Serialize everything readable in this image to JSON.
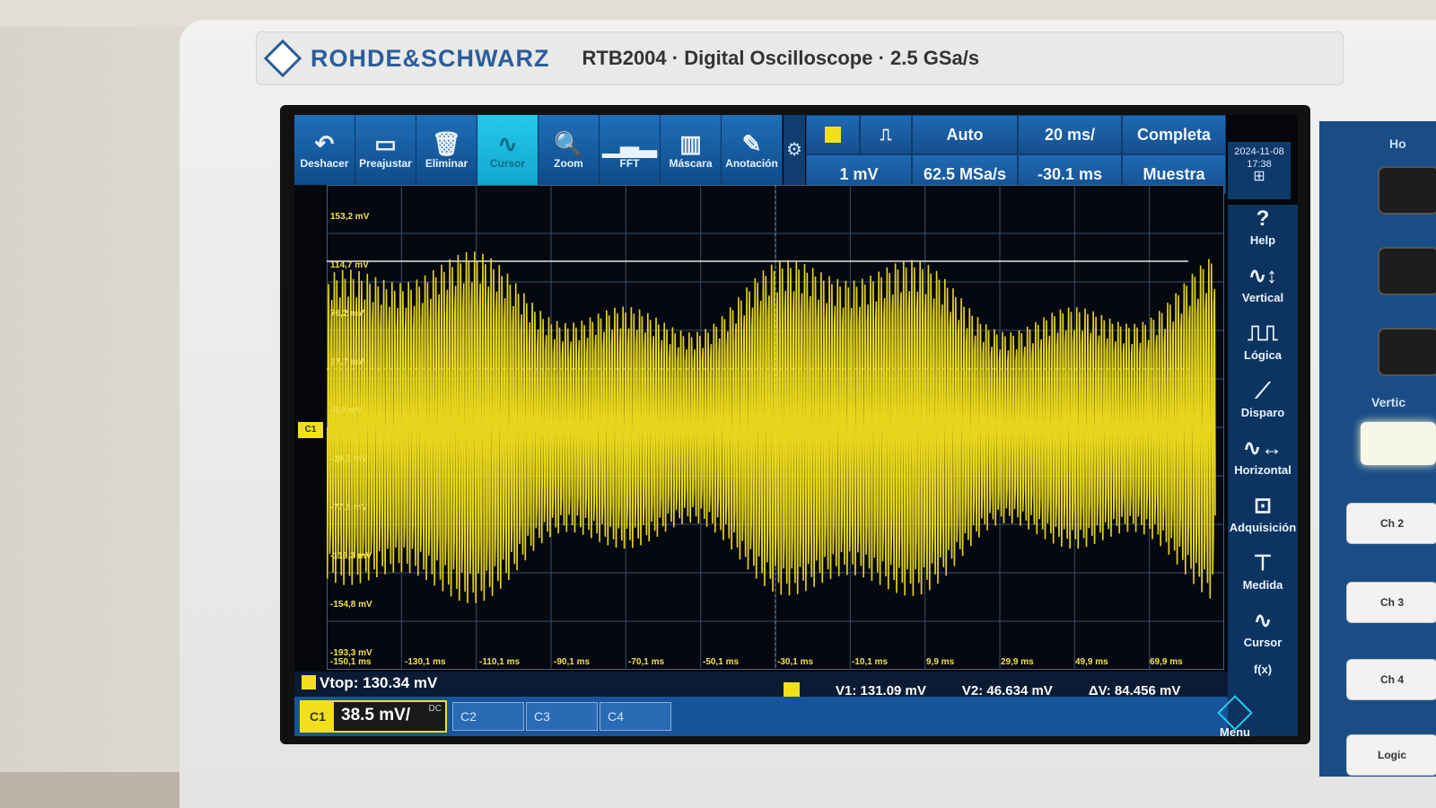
{
  "device": {
    "brand": "ROHDE&SCHWARZ",
    "model_line": "RTB2004 · Digital Oscilloscope · 2.5 GSa/s"
  },
  "toolbar": [
    {
      "label": "Deshacer",
      "icon": "undo-icon"
    },
    {
      "label": "Preajustar",
      "icon": "preset-icon"
    },
    {
      "label": "Eliminar",
      "icon": "trash-icon"
    },
    {
      "label": "Cursor",
      "icon": "cursor-wave-icon",
      "active": true
    },
    {
      "label": "Zoom",
      "icon": "magnifier-icon"
    },
    {
      "label": "FFT",
      "icon": "fft-icon"
    },
    {
      "label": "Máscara",
      "icon": "mask-icon"
    },
    {
      "label": "Anotación",
      "icon": "pen-icon"
    }
  ],
  "settings": {
    "trigger_level": "1 mV",
    "trigger_mode": "Auto",
    "sample_rate": "62.5 MSa/s",
    "timebase": "20 ms/",
    "horiz_offset": "-30.1 ms",
    "acq_mode": "Completa",
    "acq_type": "Muestra"
  },
  "datetime": {
    "date": "2024-11-08",
    "time": "17:38"
  },
  "y_labels": [
    "153,2 mV",
    "114,7 mV",
    "76,2 mV",
    "37,7 mV",
    "-0,8 mV",
    "-39,3 mV",
    "-77,8 mV",
    "-116,3 mV",
    "-154,8 mV",
    "-193,3 mV"
  ],
  "x_labels": [
    "-150,1 ms",
    "-130,1 ms",
    "-110,1 ms",
    "-90,1 ms",
    "-70,1 ms",
    "-50,1 ms",
    "-30,1 ms",
    "-10,1 ms",
    "9,9 ms",
    "29,9 ms",
    "49,9 ms",
    "69,9 ms"
  ],
  "side_menu": [
    {
      "label": "Help",
      "icon": "help-icon"
    },
    {
      "label": "Vertical",
      "icon": "vertical-icon"
    },
    {
      "label": "Lógica",
      "icon": "logic-icon"
    },
    {
      "label": "Disparo",
      "icon": "trigger-icon"
    },
    {
      "label": "Horizontal",
      "icon": "horizontal-icon"
    },
    {
      "label": "Adquisición",
      "icon": "acquisition-icon"
    },
    {
      "label": "Medida",
      "icon": "measure-icon"
    },
    {
      "label": "Cursor",
      "icon": "cursor-icon"
    },
    {
      "label": "f(x)",
      "icon": "function-icon"
    }
  ],
  "measurement": {
    "vtop": "Vtop: 130.34 mV"
  },
  "cursors": {
    "v1": "V1: 131.09 mV",
    "v2": "V2: 46.634 mV",
    "dv": "ΔV: 84.456 mV"
  },
  "channels": {
    "ch1_tag": "C1",
    "ch1_scale": "38.5 mV/",
    "ch1_coupling": "DC",
    "ch2": "C2",
    "ch3": "C3",
    "ch4": "C4"
  },
  "menu_label": "Menu",
  "right_panel": {
    "buttons": [
      "Ch 2",
      "Ch 3",
      "Ch 4",
      "Logic"
    ],
    "labels": [
      "Ho",
      "Vertic"
    ]
  },
  "colors": {
    "trace": "#f2e01c",
    "accent": "#1f6fb8"
  }
}
